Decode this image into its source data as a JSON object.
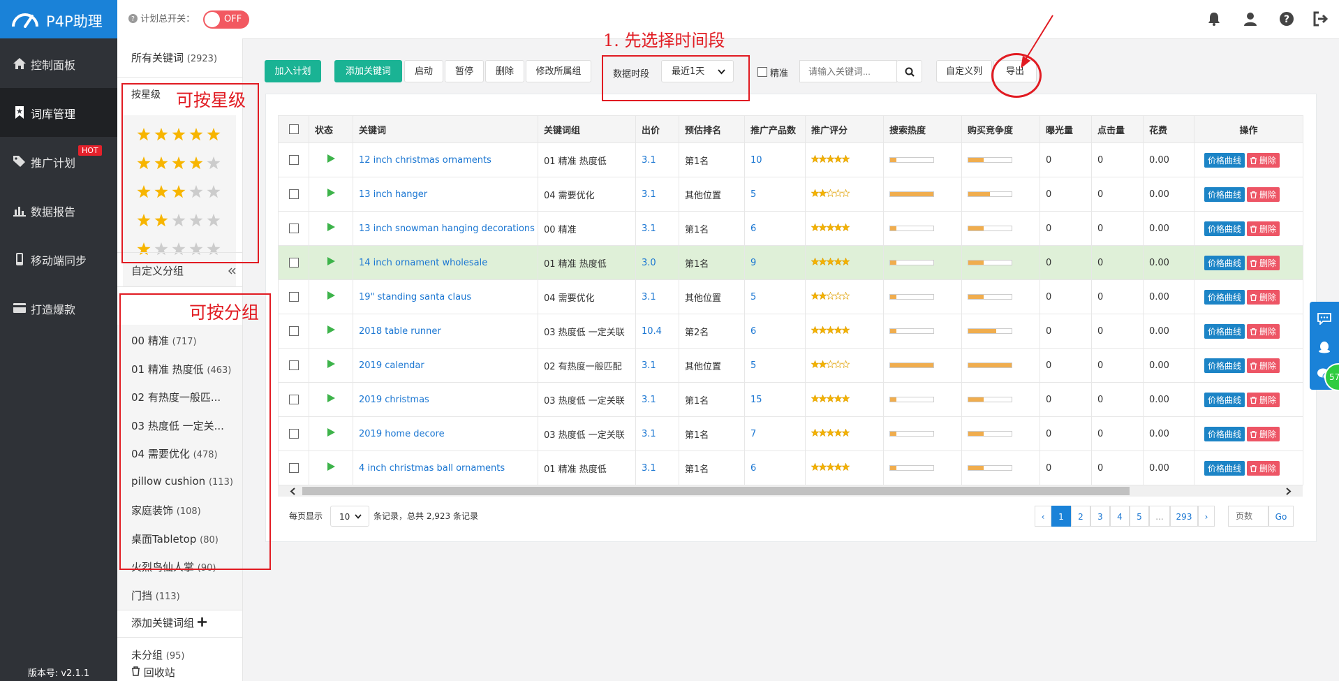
{
  "nav": {
    "app_name": "P4P助理",
    "items": [
      {
        "label": "控制面板",
        "icon": "home-icon"
      },
      {
        "label": "词库管理",
        "icon": "bookmark-icon"
      },
      {
        "label": "推广计划",
        "icon": "tag-icon",
        "badge": "HOT"
      },
      {
        "label": "数据报告",
        "icon": "bar-chart-icon"
      },
      {
        "label": "移动端同步",
        "icon": "mobile-icon"
      },
      {
        "label": "打造爆款",
        "icon": "credit-card-icon"
      }
    ],
    "version": "版本号: v2.1.1"
  },
  "header": {
    "master_switch_label": "计划总开关：",
    "toggle_text": "OFF"
  },
  "sidebar": {
    "all_keywords": "所有关键词",
    "all_count": "(2923)",
    "by_star": "按星级",
    "star_levels": [
      5,
      4,
      3,
      2,
      1
    ],
    "custom_groups": "自定义分组",
    "groups": [
      {
        "name": "00 精准",
        "count": "(717)"
      },
      {
        "name": "01 精准 热度低",
        "count": "(463)"
      },
      {
        "name": "02 有热度一般匹...",
        "count": ""
      },
      {
        "name": "03 热度低 一定关...",
        "count": ""
      },
      {
        "name": "04 需要优化",
        "count": "(478)"
      },
      {
        "name": "pillow cushion",
        "count": "(113)"
      },
      {
        "name": "家庭装饰",
        "count": "(108)"
      },
      {
        "name": "桌面Tabletop",
        "count": "(80)"
      },
      {
        "name": "火烈鸟仙人掌",
        "count": "(90)"
      },
      {
        "name": "门挡",
        "count": "(113)"
      }
    ],
    "add_group": "添加关键词组",
    "ungrouped": "未分组",
    "ungrouped_count": "(95)",
    "recycle": "回收站"
  },
  "annotations": {
    "by_star": "可按星级",
    "by_group": "可按分组",
    "step1": "1. 先选择时间段"
  },
  "toolbar": {
    "add_plan": "加入计划",
    "add_keyword": "添加关键词",
    "start": "启动",
    "pause": "暂停",
    "delete": "删除",
    "change_group": "修改所属组",
    "period_label": "数据时段",
    "period_value": "最近1天",
    "exact_label": "精准",
    "search_placeholder": "请输入关键词...",
    "custom_columns": "自定义列",
    "export": "导出"
  },
  "table": {
    "columns": [
      "状态",
      "关键词",
      "关键词组",
      "出价",
      "预估排名",
      "推广产品数",
      "推广评分",
      "搜索热度",
      "购买竞争度",
      "曝光量",
      "点击量",
      "花费",
      "操作"
    ],
    "price_curve": "价格曲线",
    "delete_label": "删除",
    "rows": [
      {
        "keyword": "12 inch christmas ornaments",
        "group": "01 精准 热度低",
        "bid": "3.1",
        "rank": "第1名",
        "products": "10",
        "rating": 5,
        "search": 0.15,
        "compete": 0.35,
        "impressions": "0",
        "clicks": "0",
        "cost": "0.00"
      },
      {
        "keyword": "13 inch hanger",
        "group": "04 需要优化",
        "bid": "3.1",
        "rank": "其他位置",
        "products": "5",
        "rating": 2,
        "search": 1.0,
        "compete": 0.5,
        "impressions": "0",
        "clicks": "0",
        "cost": "0.00"
      },
      {
        "keyword": "13 inch snowman hanging decorations",
        "group": "00 精准",
        "bid": "3.1",
        "rank": "第1名",
        "products": "6",
        "rating": 5,
        "search": 0.15,
        "compete": 0.35,
        "impressions": "0",
        "clicks": "0",
        "cost": "0.00"
      },
      {
        "keyword": "14 inch ornament wholesale",
        "group": "01 精准 热度低",
        "bid": "3.0",
        "rank": "第1名",
        "products": "9",
        "rating": 5,
        "search": 0.15,
        "compete": 0.35,
        "impressions": "0",
        "clicks": "0",
        "cost": "0.00",
        "highlight": true
      },
      {
        "keyword": "19\" standing santa claus",
        "group": "04 需要优化",
        "bid": "3.1",
        "rank": "其他位置",
        "products": "5",
        "rating": 2,
        "search": 0.15,
        "compete": 0.35,
        "impressions": "0",
        "clicks": "0",
        "cost": "0.00"
      },
      {
        "keyword": "2018 table runner",
        "group": "03 热度低 一定关联",
        "bid": "10.4",
        "rank": "第2名",
        "products": "6",
        "rating": 5,
        "search": 0.15,
        "compete": 0.65,
        "impressions": "0",
        "clicks": "0",
        "cost": "0.00"
      },
      {
        "keyword": "2019 calendar",
        "group": "02 有热度一般匹配",
        "bid": "3.1",
        "rank": "其他位置",
        "products": "5",
        "rating": 2,
        "search": 1.0,
        "compete": 1.0,
        "impressions": "0",
        "clicks": "0",
        "cost": "0.00"
      },
      {
        "keyword": "2019 christmas",
        "group": "03 热度低 一定关联",
        "bid": "3.1",
        "rank": "第1名",
        "products": "15",
        "rating": 5,
        "search": 0.15,
        "compete": 0.35,
        "impressions": "0",
        "clicks": "0",
        "cost": "0.00"
      },
      {
        "keyword": "2019 home decore",
        "group": "03 热度低 一定关联",
        "bid": "3.1",
        "rank": "第1名",
        "products": "7",
        "rating": 5,
        "search": 0.15,
        "compete": 0.35,
        "impressions": "0",
        "clicks": "0",
        "cost": "0.00"
      },
      {
        "keyword": "4 inch christmas ball ornaments",
        "group": "01 精准 热度低",
        "bid": "3.1",
        "rank": "第1名",
        "products": "6",
        "rating": 5,
        "search": 0.15,
        "compete": 0.35,
        "impressions": "0",
        "clicks": "0",
        "cost": "0.00"
      }
    ]
  },
  "footer": {
    "per_page_label": "每页显示",
    "per_page_value": "10",
    "records_text": "条记录，总共 2,923 条记录",
    "pages": [
      "1",
      "2",
      "3",
      "4",
      "5",
      "...",
      "293"
    ],
    "prev": "‹",
    "next": "›",
    "page_placeholder": "页数",
    "go": "Go"
  },
  "floating": {
    "badge": "57"
  }
}
